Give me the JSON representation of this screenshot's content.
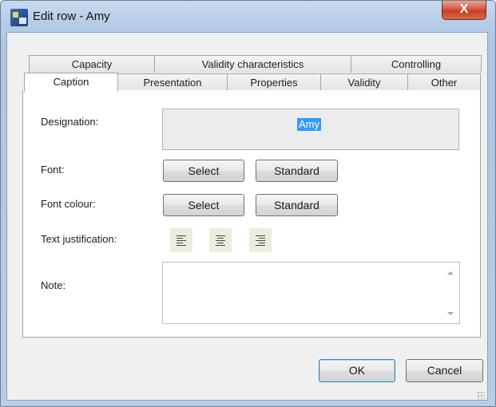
{
  "window": {
    "title": "Edit row - Amy",
    "close_glyph": "X",
    "icon": "app-icon"
  },
  "tabs": {
    "row1": [
      "Capacity",
      "Validity characteristics",
      "Controlling"
    ],
    "row2": [
      "Caption",
      "Presentation",
      "Properties",
      "Validity",
      "Other"
    ],
    "selected": "Caption"
  },
  "form": {
    "designation_label": "Designation:",
    "designation_value": "Amy",
    "font_label": "Font:",
    "font_colour_label": "Font colour:",
    "text_justification_label": "Text justification:",
    "note_label": "Note:",
    "note_value": "",
    "select_label": "Select",
    "standard_label": "Standard",
    "justify_icons": [
      "align-left-icon",
      "align-center-icon",
      "align-right-icon"
    ]
  },
  "footer": {
    "ok_label": "OK",
    "cancel_label": "Cancel"
  },
  "colors": {
    "selection": "#3399ff",
    "close_button": "#c63d22",
    "title_bar": "#b5cbe6"
  }
}
